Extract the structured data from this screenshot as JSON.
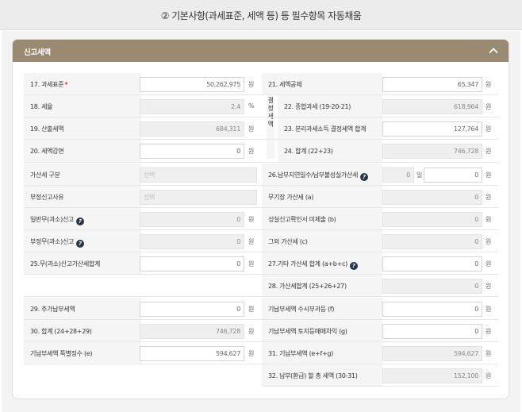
{
  "header": {
    "title": "② 기본사항(과세표준, 세액 등) 등 필수항목 자동채움"
  },
  "panel": {
    "title": "신고세액",
    "toggle_icon": "chevron-up-icon"
  },
  "group_label": "결정세액",
  "left": {
    "tax_base": {
      "label": "17. 과세표준",
      "required_mark": "*",
      "value": "50,262,975",
      "unit": "원"
    },
    "tax_rate": {
      "label": "18. 세율",
      "value": "2.4",
      "unit": "%"
    },
    "calc_tax": {
      "label": "19. 산출세액",
      "value": "684,311",
      "unit": "원"
    },
    "tax_reduce": {
      "label": "20. 세액감면",
      "value": "0",
      "unit": "원"
    },
    "penalty_type": {
      "label": "가산세 구분",
      "placeholder": "선택"
    },
    "improper_reason": {
      "label": "부정신고사유",
      "placeholder": "선택"
    },
    "general_under": {
      "label": "일반무(과소)신고",
      "value": "0",
      "unit": "원"
    },
    "improper_under": {
      "label": "부정무(과소)신고",
      "value": "0",
      "unit": "원"
    },
    "under_total": {
      "label": "25.무(과소)신고가산세합계",
      "value": "0",
      "unit": "원"
    },
    "add_payment": {
      "label": "29. 추가납부세액",
      "value": "0",
      "unit": "원"
    },
    "total30": {
      "label": "30. 합계 (24+28+29)",
      "value": "746,728",
      "unit": "원"
    },
    "special_collect": {
      "label": "기납부세액 특별징수 (e)",
      "value": "594,627",
      "unit": "원"
    }
  },
  "right": {
    "deduction": {
      "label": "21. 세액공제",
      "value": "65,347",
      "unit": "원"
    },
    "comprehensive": {
      "label": "22. 종합과세 (19-20-21)",
      "value": "618,964",
      "unit": "원"
    },
    "separate": {
      "label": "23. 분리과세소득 결정세액 합계",
      "value": "127,764",
      "unit": "원"
    },
    "sum24": {
      "label": "24. 합계 (22+23)",
      "value": "746,728",
      "unit": "원"
    },
    "late_days": {
      "label": "26.납부지연일수/납부불성실가산세",
      "days": "0",
      "days_unit": "일",
      "value": "0",
      "unit": "원"
    },
    "no_book": {
      "label": "무기장 가산세 (a)",
      "value": "0",
      "unit": "원"
    },
    "no_confirm": {
      "label": "성실신고확인서 미제출 (b)",
      "value": "0",
      "unit": "원"
    },
    "other_penalty": {
      "label": "그외 가산세 (c)",
      "value": "0",
      "unit": "원"
    },
    "other_total": {
      "label": "27.기타 가산세 합계 (a+b+c)",
      "value": "0",
      "unit": "원"
    },
    "penalty_total": {
      "label": "28. 가산세합계 (25+26+27)",
      "value": "0",
      "unit": "원"
    },
    "occasional": {
      "label": "기납부세액 수시부과등 (f)",
      "value": "0",
      "unit": "원"
    },
    "land_sale": {
      "label": "기납부세액 토지등매매차익 (g)",
      "value": "0",
      "unit": "원"
    },
    "prepaid_total": {
      "label": "31. 기납부세액 (e+f+g)",
      "value": "594,627",
      "unit": "원"
    },
    "final_tax": {
      "label": "32. 납부(환급) 할 총 세액 (30-31)",
      "value": "152,100",
      "unit": "원"
    }
  },
  "colors": {
    "header_bar": "#9a8a71",
    "required": "#e03a3a",
    "help_icon": "#2b3345"
  }
}
